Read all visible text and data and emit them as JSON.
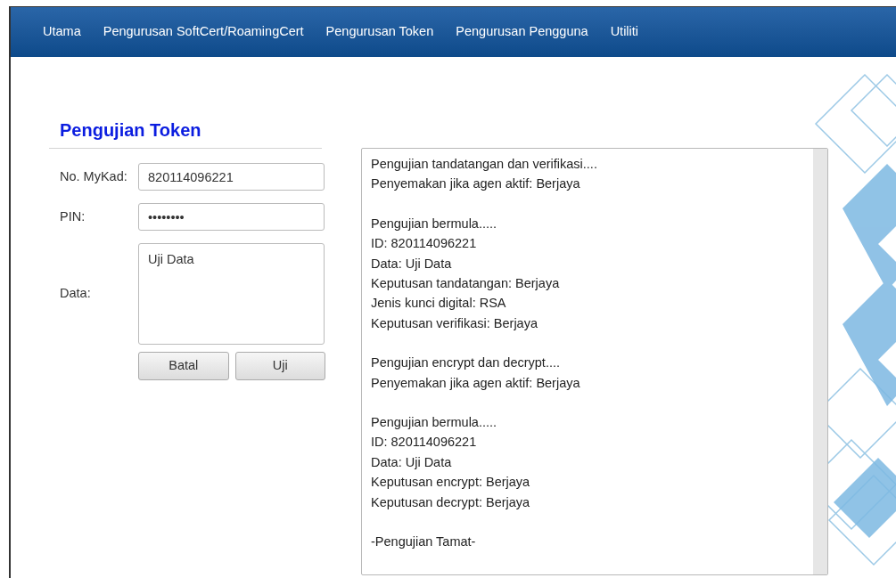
{
  "nav": {
    "items": [
      {
        "label": "Utama"
      },
      {
        "label": "Pengurusan SoftCert/RoamingCert"
      },
      {
        "label": "Pengurusan Token"
      },
      {
        "label": "Pengurusan Pengguna"
      },
      {
        "label": "Utiliti"
      }
    ]
  },
  "form": {
    "title": "Pengujian Token",
    "fields": [
      {
        "kind": "input",
        "label": "No. MyKad:",
        "value": "820114096221"
      },
      {
        "kind": "input",
        "label": "PIN:",
        "value": "••••••••"
      },
      {
        "kind": "textarea",
        "label": "Data:",
        "value": "Uji Data"
      }
    ],
    "buttons": [
      "Batal",
      "Uji"
    ]
  },
  "output": {
    "paragraphs": [
      [
        "Pengujian tandatangan dan verifikasi....",
        "Penyemakan jika agen aktif: Berjaya"
      ],
      [
        "Pengujian bermula.....",
        "ID: 820114096221",
        "Data: Uji Data",
        "Keputusan tandatangan: Berjaya",
        "Jenis kunci digital: RSA",
        "Keputusan verifikasi: Berjaya"
      ],
      [
        "Pengujian encrypt dan decrypt....",
        "Penyemakan jika agen aktif: Berjaya"
      ],
      [
        "Pengujian bermula.....",
        "ID: 820114096221",
        "Data: Uji Data",
        "Keputusan encrypt: Berjaya",
        "Keputusan decrypt: Berjaya"
      ],
      [
        "-Pengujian Tamat-"
      ]
    ]
  }
}
